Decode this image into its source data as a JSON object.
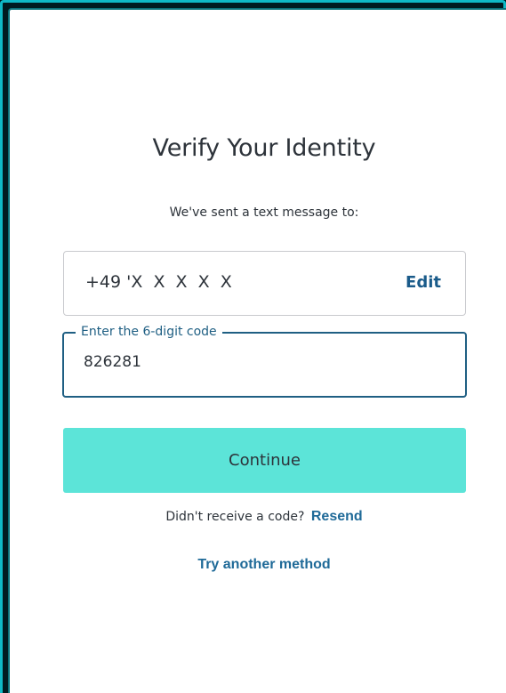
{
  "page": {
    "title": "Verify Your Identity",
    "subtitle": "We've sent a text message to:"
  },
  "phone": {
    "number": "+49 'X  X  X  X  X",
    "edit_label": "Edit"
  },
  "code_field": {
    "label": "Enter the 6-digit code",
    "value": "826281"
  },
  "actions": {
    "continue_label": "Continue",
    "resend_prompt": "Didn't receive a code?",
    "resend_label": "Resend",
    "another_method_label": "Try another method"
  },
  "colors": {
    "accent_button": "#5ce4d8",
    "link": "#1f6a98",
    "focus_border": "#1f5f83",
    "frame_border": "#0fb9c6"
  }
}
